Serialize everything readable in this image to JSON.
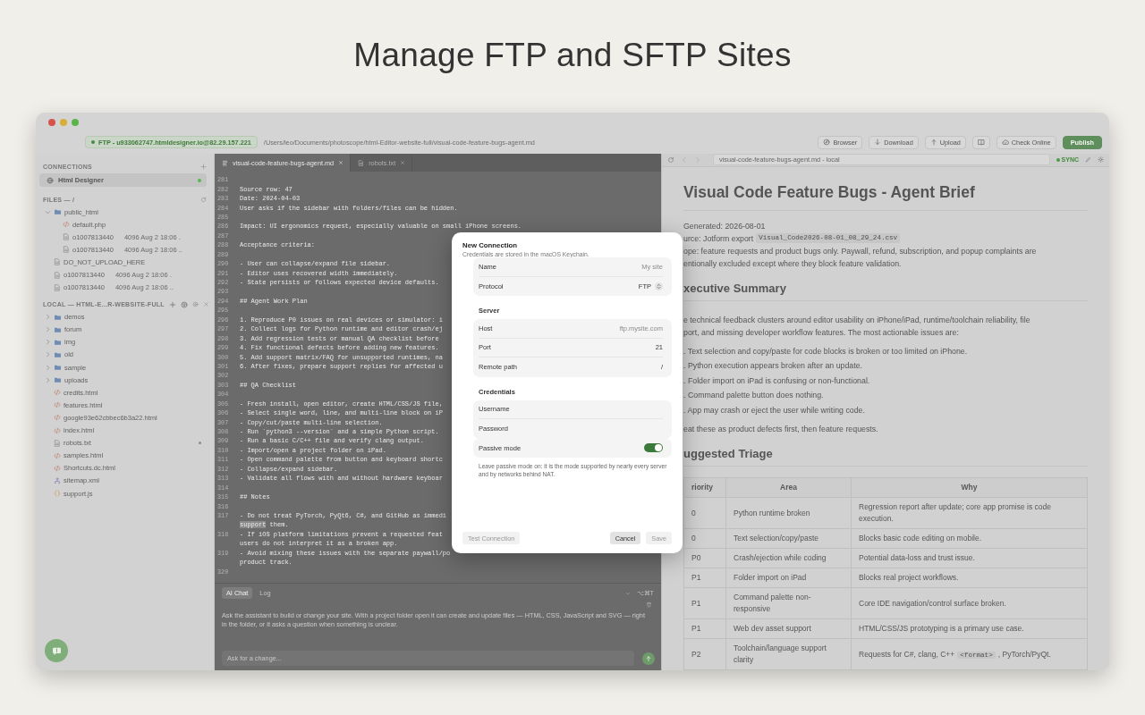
{
  "headline": "Manage FTP and SFTP Sites",
  "toolbar": {
    "connection": "FTP - u933062747.htmldesigner.io@82.29.157.221",
    "path": "/Users/leo/Documents/photoscope/html-Editor-website-full/visual-code-feature-bugs-agent.md",
    "buttons": [
      {
        "label": "Browser",
        "kind": "browser"
      },
      {
        "label": "Download",
        "kind": "download"
      },
      {
        "label": "Upload",
        "kind": "upload"
      },
      {
        "kind": "book"
      },
      {
        "label": "Check Online",
        "kind": "cloud"
      },
      {
        "label": "Publish",
        "kind": "primary"
      }
    ]
  },
  "sidebar": {
    "connections_title": "CONNECTIONS",
    "connections": [
      {
        "name": "Html Designer",
        "selected": true,
        "online": true
      }
    ],
    "files_title": "FILES — /",
    "remote_tree": [
      {
        "name": "public_html",
        "kind": "folder",
        "expanded": true,
        "children": [
          {
            "name": "default.php",
            "kind": "code"
          },
          {
            "name": "o1007813440",
            "meta": "4096 Aug  2 18:06 .",
            "kind": "file"
          },
          {
            "name": "o1007813440",
            "meta": "4096 Aug  2 18:06 ..",
            "kind": "file"
          }
        ]
      },
      {
        "name": "DO_NOT_UPLOAD_HERE",
        "kind": "file"
      },
      {
        "name": "o1007813440",
        "meta": "4096 Aug  2 18:06 .",
        "kind": "file"
      },
      {
        "name": "o1007813440",
        "meta": "4096 Aug  2 18:06 ..",
        "kind": "file"
      }
    ],
    "local_title": "LOCAL — HTML-E...R-WEBSITE-FULL",
    "local_tree": [
      {
        "name": "demos",
        "kind": "folder",
        "expanded": false,
        "modified": false
      },
      {
        "name": "forum",
        "kind": "folder",
        "expanded": false,
        "modified": false
      },
      {
        "name": "img",
        "kind": "folder",
        "expanded": false,
        "modified": false
      },
      {
        "name": "old",
        "kind": "folder",
        "expanded": false,
        "modified": false
      },
      {
        "name": "sample",
        "kind": "folder",
        "expanded": false,
        "modified": false
      },
      {
        "name": "uploads",
        "kind": "folder",
        "expanded": false,
        "modified": false
      },
      {
        "name": "credits.html",
        "kind": "code",
        "modified": false
      },
      {
        "name": "features.html",
        "kind": "code",
        "modified": false
      },
      {
        "name": "google93e62cbbec6b3a22.html",
        "kind": "code",
        "modified": false
      },
      {
        "name": "index.html",
        "kind": "code",
        "modified": false
      },
      {
        "name": "robots.txt",
        "kind": "file",
        "modified": true
      },
      {
        "name": "samples.html",
        "kind": "code",
        "modified": false
      },
      {
        "name": "Shortcuts.dc.html",
        "kind": "code",
        "modified": false
      },
      {
        "name": "sitemap.xml",
        "kind": "sitemap",
        "modified": false
      },
      {
        "name": "support.js",
        "kind": "script",
        "modified": false
      }
    ]
  },
  "editor": {
    "tabs": [
      {
        "label": "visual-code-feature-bugs-agent.md",
        "selected": true
      },
      {
        "label": "robots.txt",
        "selected": false
      }
    ],
    "lines": [
      {
        "number": "281"
      },
      {
        "number": "282",
        "text": "Source row: 47"
      },
      {
        "number": "283",
        "text": "Date: 2024-04-03"
      },
      {
        "number": "284",
        "text": "User asks if the sidebar with folders/files can be hidden."
      },
      {
        "number": "285"
      },
      {
        "number": "286",
        "text": "Impact: UI ergonomics request, especially valuable on small iPhone screens."
      },
      {
        "number": "287"
      },
      {
        "number": "288",
        "text": "Acceptance criteria:"
      },
      {
        "number": "289"
      },
      {
        "number": "290",
        "text": "- User can collapse/expand file sidebar."
      },
      {
        "number": "291",
        "text": "- Editor uses recovered width immediately."
      },
      {
        "number": "292",
        "text": "- State persists or follows expected device defaults."
      },
      {
        "number": "293"
      },
      {
        "number": "294",
        "text": "## Agent Work Plan"
      },
      {
        "number": "295"
      },
      {
        "number": "296",
        "text": "1. Reproduce P0 issues on real devices or simulator: i"
      },
      {
        "number": "297",
        "text": "2. Collect logs for Python runtime and editor crash/ej"
      },
      {
        "number": "298",
        "text": "3. Add regression tests or manual QA checklist before"
      },
      {
        "number": "299",
        "text": "4. Fix functional defects before adding new features."
      },
      {
        "number": "300",
        "text": "5. Add support matrix/FAQ for unsupported runtimes, na"
      },
      {
        "number": "301",
        "text": "6. After fixes, prepare support replies for affected u"
      },
      {
        "number": "302"
      },
      {
        "number": "303",
        "text": "## QA Checklist"
      },
      {
        "number": "304"
      },
      {
        "number": "305",
        "text": "- Fresh install, open editor, create HTML/CSS/JS file,"
      },
      {
        "number": "306",
        "text": "- Select single word, line, and multi-line block on iP"
      },
      {
        "number": "307",
        "text": "- Copy/cut/paste multi-line selection."
      },
      {
        "number": "308",
        "text": "- Run `python3 --version` and a simple Python script."
      },
      {
        "number": "309",
        "text": "- Run a basic C/C++ file and verify clang output."
      },
      {
        "number": "310",
        "text": "- Import/open a project folder on iPad."
      },
      {
        "number": "311",
        "text": "- Open command palette from button and keyboard shortc"
      },
      {
        "number": "312",
        "text": "- Collapse/expand sidebar."
      },
      {
        "number": "313",
        "text": "- Validate all flows with and without hardware keyboar"
      },
      {
        "number": "314"
      },
      {
        "number": "315",
        "text": "## Notes"
      },
      {
        "number": "316"
      },
      {
        "number": "317",
        "text": "- Do not treat PyTorch, PyQt6, C#, and GitHub as immedi"
      },
      {
        "parts": [
          {
            "text": "support",
            "selected": true
          },
          {
            "text": " them.",
            "selected": false
          }
        ]
      },
      {
        "number": "318",
        "text": "- If iOS platform limitations prevent a requested feat"
      },
      {
        "text": "users do not interpret it as a broken app."
      },
      {
        "number": "319",
        "text": "- Avoid mixing these issues with the separate paywall/po"
      },
      {
        "text": "product track."
      },
      {
        "number": "320"
      }
    ]
  },
  "ai_panel": {
    "tabs": [
      {
        "label": "AI Chat",
        "selected": true
      },
      {
        "label": "Log",
        "selected": false
      }
    ],
    "shortcut": "⌥⌘T",
    "message": "Ask the assistant to build or change your site. With a project folder open it can create and update files — HTML, CSS, JavaScript and SVG — right in the folder, or it asks a question when something is unclear.",
    "input": {
      "placeholder": "Ask for a change..."
    }
  },
  "preview": {
    "address": "visual-code-feature-bugs-agent.md - local",
    "sync": "SYNC",
    "blocks": [
      {
        "kind": "h1",
        "text": "Visual Code Feature Bugs - Agent Brief"
      },
      {
        "kind": "p",
        "lines": [
          [
            {
              "text": "Generated: 2026-08-01",
              "code": false
            }
          ],
          [
            {
              "text": "urce: Jotform export",
              "code": false
            },
            {
              "text": "Visual_Code2026-08-01_08_29_24.csv",
              "code": true
            }
          ],
          [
            {
              "text": "ope: feature requests and product bugs only. Paywall, refund, subscription, and popup complaints are",
              "code": false
            }
          ],
          [
            {
              "text": "entionally excluded except where they block feature validation.",
              "code": false
            }
          ]
        ]
      },
      {
        "kind": "h2",
        "text": "xecutive Summary"
      },
      {
        "kind": "p",
        "lines": [
          [
            {
              "text": "e technical feedback clusters around editor usability on iPhone/iPad, runtime/toolchain reliability, file",
              "code": false
            }
          ],
          [
            {
              "text": "port, and missing developer workflow features. The most actionable issues are:",
              "code": false
            }
          ]
        ]
      },
      {
        "kind": "list",
        "items": [
          ". Text selection and copy/paste for code blocks is broken or too limited on iPhone.",
          ". Python execution appears broken after an update.",
          ". Folder import on iPad is confusing or non-functional.",
          ". Command palette button does nothing.",
          ". App may crash or eject the user while writing code."
        ]
      },
      {
        "kind": "p",
        "lines": [
          [
            {
              "text": "eat these as product defects first, then feature requests.",
              "code": false
            }
          ]
        ]
      },
      {
        "kind": "h2",
        "text": "uggested Triage"
      },
      {
        "kind": "table",
        "columns": [
          "riority",
          "Area",
          "Why"
        ],
        "rows": [
          [
            "0",
            "Python runtime broken",
            "Regression report after update; core app promise is code execution."
          ],
          [
            "0",
            "Text selection/copy/paste",
            "Blocks basic code editing on mobile."
          ],
          [
            "P0",
            "Crash/ejection while coding",
            "Potential data-loss and trust issue."
          ],
          [
            "P1",
            "Folder import on iPad",
            "Blocks real project workflows."
          ],
          [
            "P1",
            "Command palette non-responsive",
            "Core IDE navigation/control surface broken."
          ],
          [
            "P1",
            "Web dev asset support",
            "HTML/CSS/JS prototyping is a primary use case."
          ],
          [
            "P2",
            "Toolchain/language support clarity",
            [
              {
                "text": "Requests for C#, clang, C++",
                "code": false
              },
              {
                "text": "<format>",
                "code": true
              },
              {
                "text": ", PyTorch/PyQt.",
                "code": false
              }
            ]
          ]
        ]
      }
    ]
  },
  "dialog": {
    "title": "New Connection",
    "subtitle": "Credentials are stored in the macOS Keychain.",
    "sections": [
      {
        "fields": [
          {
            "label": "Name",
            "kind": "text",
            "placeholder": "My site"
          },
          {
            "label": "Protocol",
            "kind": "select",
            "value": "FTP"
          }
        ]
      },
      {
        "title": "Server",
        "fields": [
          {
            "label": "Host",
            "kind": "text",
            "placeholder": "ftp.mysite.com"
          },
          {
            "label": "Port",
            "kind": "text",
            "value": "21"
          },
          {
            "label": "Remote path",
            "kind": "text",
            "value": "/"
          }
        ]
      },
      {
        "title": "Credentials",
        "fields": [
          {
            "label": "Username",
            "kind": "text"
          },
          {
            "label": "Password",
            "kind": "password"
          }
        ]
      },
      {
        "fields": [
          {
            "label": "Passive mode",
            "kind": "toggle",
            "on": true
          }
        ]
      }
    ],
    "hint": "Leave passive mode on: it is the mode supported by nearly every server and by networks behind NAT.",
    "buttons": [
      {
        "label": "Test Connection",
        "disabled": true
      },
      {
        "label": "Cancel",
        "disabled": false
      },
      {
        "label": "Save",
        "disabled": true
      }
    ]
  }
}
